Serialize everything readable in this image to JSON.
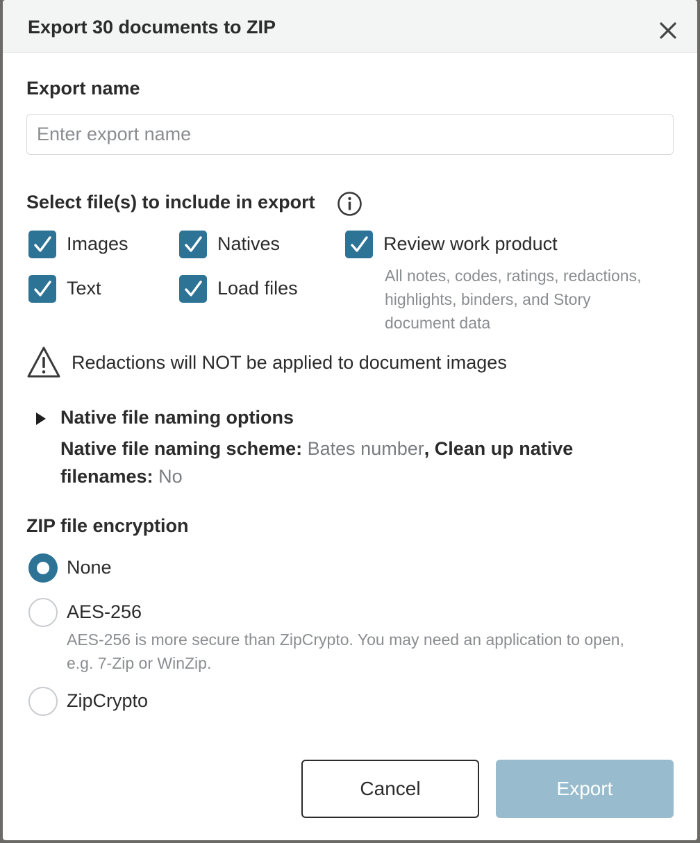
{
  "dialog": {
    "title": "Export 30 documents to ZIP",
    "close_icon": "close-icon"
  },
  "export_name": {
    "label": "Export name",
    "value": "",
    "placeholder": "Enter export name"
  },
  "files": {
    "label": "Select file(s) to include in export",
    "info_icon": "info-icon",
    "options": [
      {
        "label": "Images",
        "checked": true
      },
      {
        "label": "Natives",
        "checked": true
      },
      {
        "label": "Review work product",
        "checked": true
      },
      {
        "label": "Text",
        "checked": true
      },
      {
        "label": "Load files",
        "checked": true
      }
    ],
    "review_note_lines": [
      "All notes, codes, ratings, redactions,",
      "highlights, binders, and Story",
      "document data"
    ]
  },
  "warning": {
    "icon": "warning-icon",
    "text": "Redactions will NOT be applied to document images"
  },
  "naming": {
    "toggle_label": "Native file naming options",
    "scheme_label": "Native file naming scheme:",
    "scheme_value": "Bates number",
    "cleanup_label": ", Clean up native filenames:",
    "cleanup_value": "No"
  },
  "encryption": {
    "label": "ZIP file encryption",
    "options": [
      {
        "label": "None",
        "selected": true
      },
      {
        "label": "AES-256",
        "selected": false
      },
      {
        "label": "ZipCrypto",
        "selected": false
      }
    ],
    "aes_note_lines": [
      "AES-256 is more secure than ZipCrypto. You may need an application to open,",
      "e.g. 7-Zip or WinZip."
    ]
  },
  "footer": {
    "cancel_label": "Cancel",
    "export_label": "Export"
  },
  "colors": {
    "accent": "#2d7396",
    "export_disabled": "#98bccd",
    "header_bg": "#f3f4f4",
    "muted_text": "#8a8d8f"
  }
}
